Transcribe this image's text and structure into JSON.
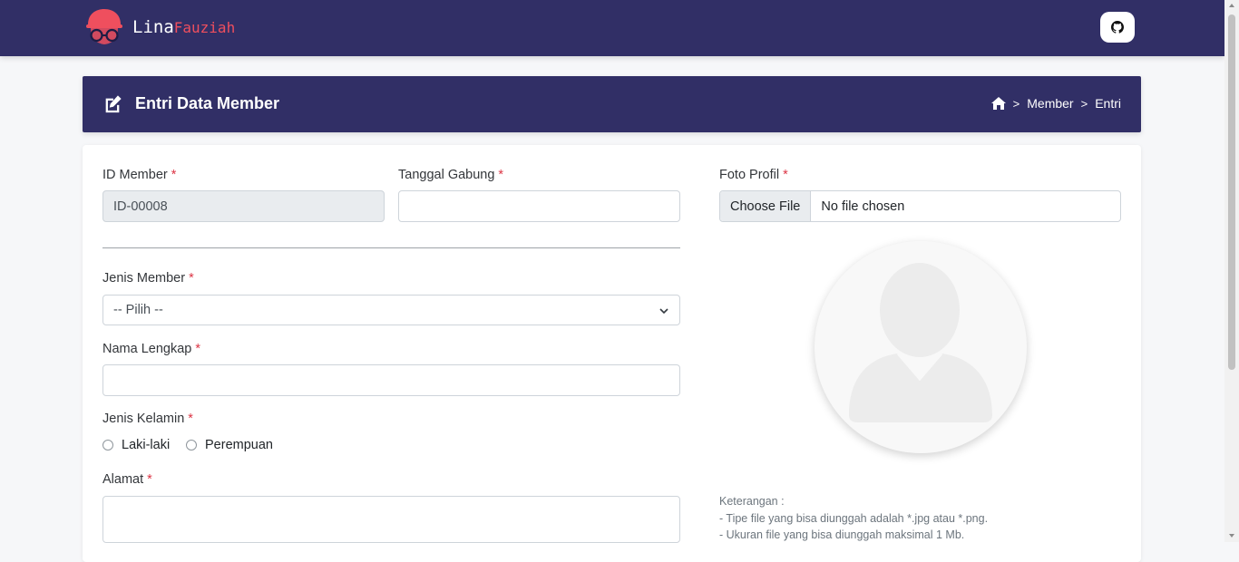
{
  "brand": {
    "first": "Lina",
    "last": "Fauziah"
  },
  "header": {
    "title": "Entri Data Member",
    "breadcrumb": {
      "sep": ">",
      "member": "Member",
      "entri": "Entri"
    }
  },
  "form": {
    "id_member": {
      "label": "ID Member",
      "value": "ID-00008"
    },
    "tanggal_gabung": {
      "label": "Tanggal Gabung",
      "value": ""
    },
    "foto_profil": {
      "label": "Foto Profil",
      "button": "Choose File",
      "status": "No file chosen"
    },
    "jenis_member": {
      "label": "Jenis Member",
      "selected": "-- Pilih --"
    },
    "nama_lengkap": {
      "label": "Nama Lengkap",
      "value": ""
    },
    "jenis_kelamin": {
      "label": "Jenis Kelamin",
      "options": [
        "Laki-laki",
        "Perempuan"
      ]
    },
    "alamat": {
      "label": "Alamat",
      "value": ""
    },
    "required_mark": "*"
  },
  "notes": {
    "title": "Keterangan :",
    "line1": "- Tipe file yang bisa diunggah adalah *.jpg atau *.png.",
    "line2": "- Ukuran file yang bisa diunggah maksimal 1 Mb."
  },
  "colors": {
    "primary": "#312f66",
    "accent": "#ef4f5e",
    "required": "#dc3545"
  },
  "icons": [
    "logo-icon",
    "github-icon",
    "edit-icon",
    "home-icon",
    "chevron-down-icon",
    "avatar-placeholder-icon"
  ]
}
